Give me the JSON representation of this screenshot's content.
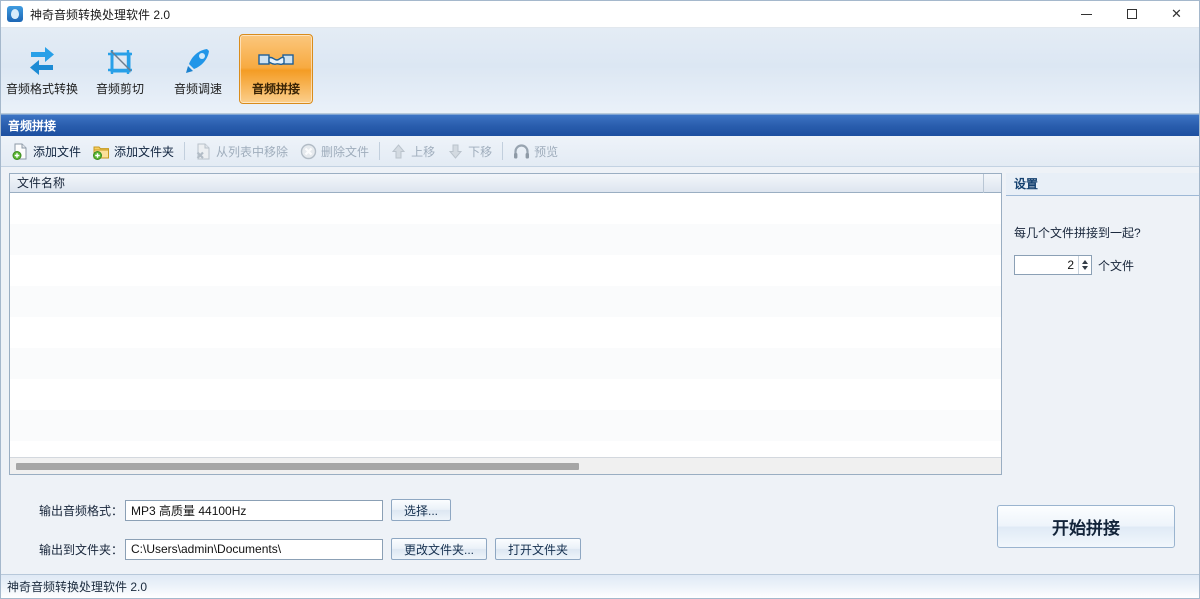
{
  "window": {
    "title": "神奇音频转换处理软件 2.0",
    "app_icon": "app-logo-icon",
    "minimize_label": "–",
    "maximize_label": "□",
    "close_label": "✕"
  },
  "tabs": [
    {
      "label": "音频格式转换",
      "icon": "convert-arrows-icon",
      "active": false
    },
    {
      "label": "音频剪切",
      "icon": "crop-icon",
      "active": false
    },
    {
      "label": "音频调速",
      "icon": "rocket-icon",
      "active": false
    },
    {
      "label": "音频拼接",
      "icon": "handshake-icon",
      "active": true
    }
  ],
  "section": {
    "title": "音频拼接"
  },
  "toolbar": {
    "items": [
      {
        "label": "添加文件",
        "icon": "add-file-icon",
        "enabled": true
      },
      {
        "label": "添加文件夹",
        "icon": "add-folder-icon",
        "enabled": true
      },
      {
        "label": "从列表中移除",
        "icon": "remove-file-icon",
        "enabled": false
      },
      {
        "label": "删除文件",
        "icon": "delete-file-icon",
        "enabled": false
      },
      {
        "label": "上移",
        "icon": "arrow-up-icon",
        "enabled": false
      },
      {
        "label": "下移",
        "icon": "arrow-down-icon",
        "enabled": false
      },
      {
        "label": "预览",
        "icon": "headphones-icon",
        "enabled": false
      }
    ]
  },
  "file_list": {
    "columns": [
      "文件名称"
    ],
    "rows": [],
    "row_count": 0
  },
  "settings": {
    "title": "设置",
    "question": "每几个文件拼接到一起?",
    "count_value": "2",
    "count_unit": "个文件"
  },
  "output": {
    "format_label": "输出音频格式：",
    "format_value": "MP3 高质量 44100Hz",
    "format_button": "选择...",
    "folder_label": "输出到文件夹：",
    "folder_value": "C:\\Users\\admin\\Documents\\",
    "change_folder_button": "更改文件夹...",
    "open_folder_button": "打开文件夹"
  },
  "action": {
    "start_button": "开始拼接"
  },
  "statusbar": {
    "text": "神奇音频转换处理软件 2.0"
  },
  "colors": {
    "accent_blue": "#2a5eae",
    "active_tab_orange": "#f49c24",
    "icon_blue": "#2196e8",
    "disabled_gray": "#9fadbc"
  }
}
